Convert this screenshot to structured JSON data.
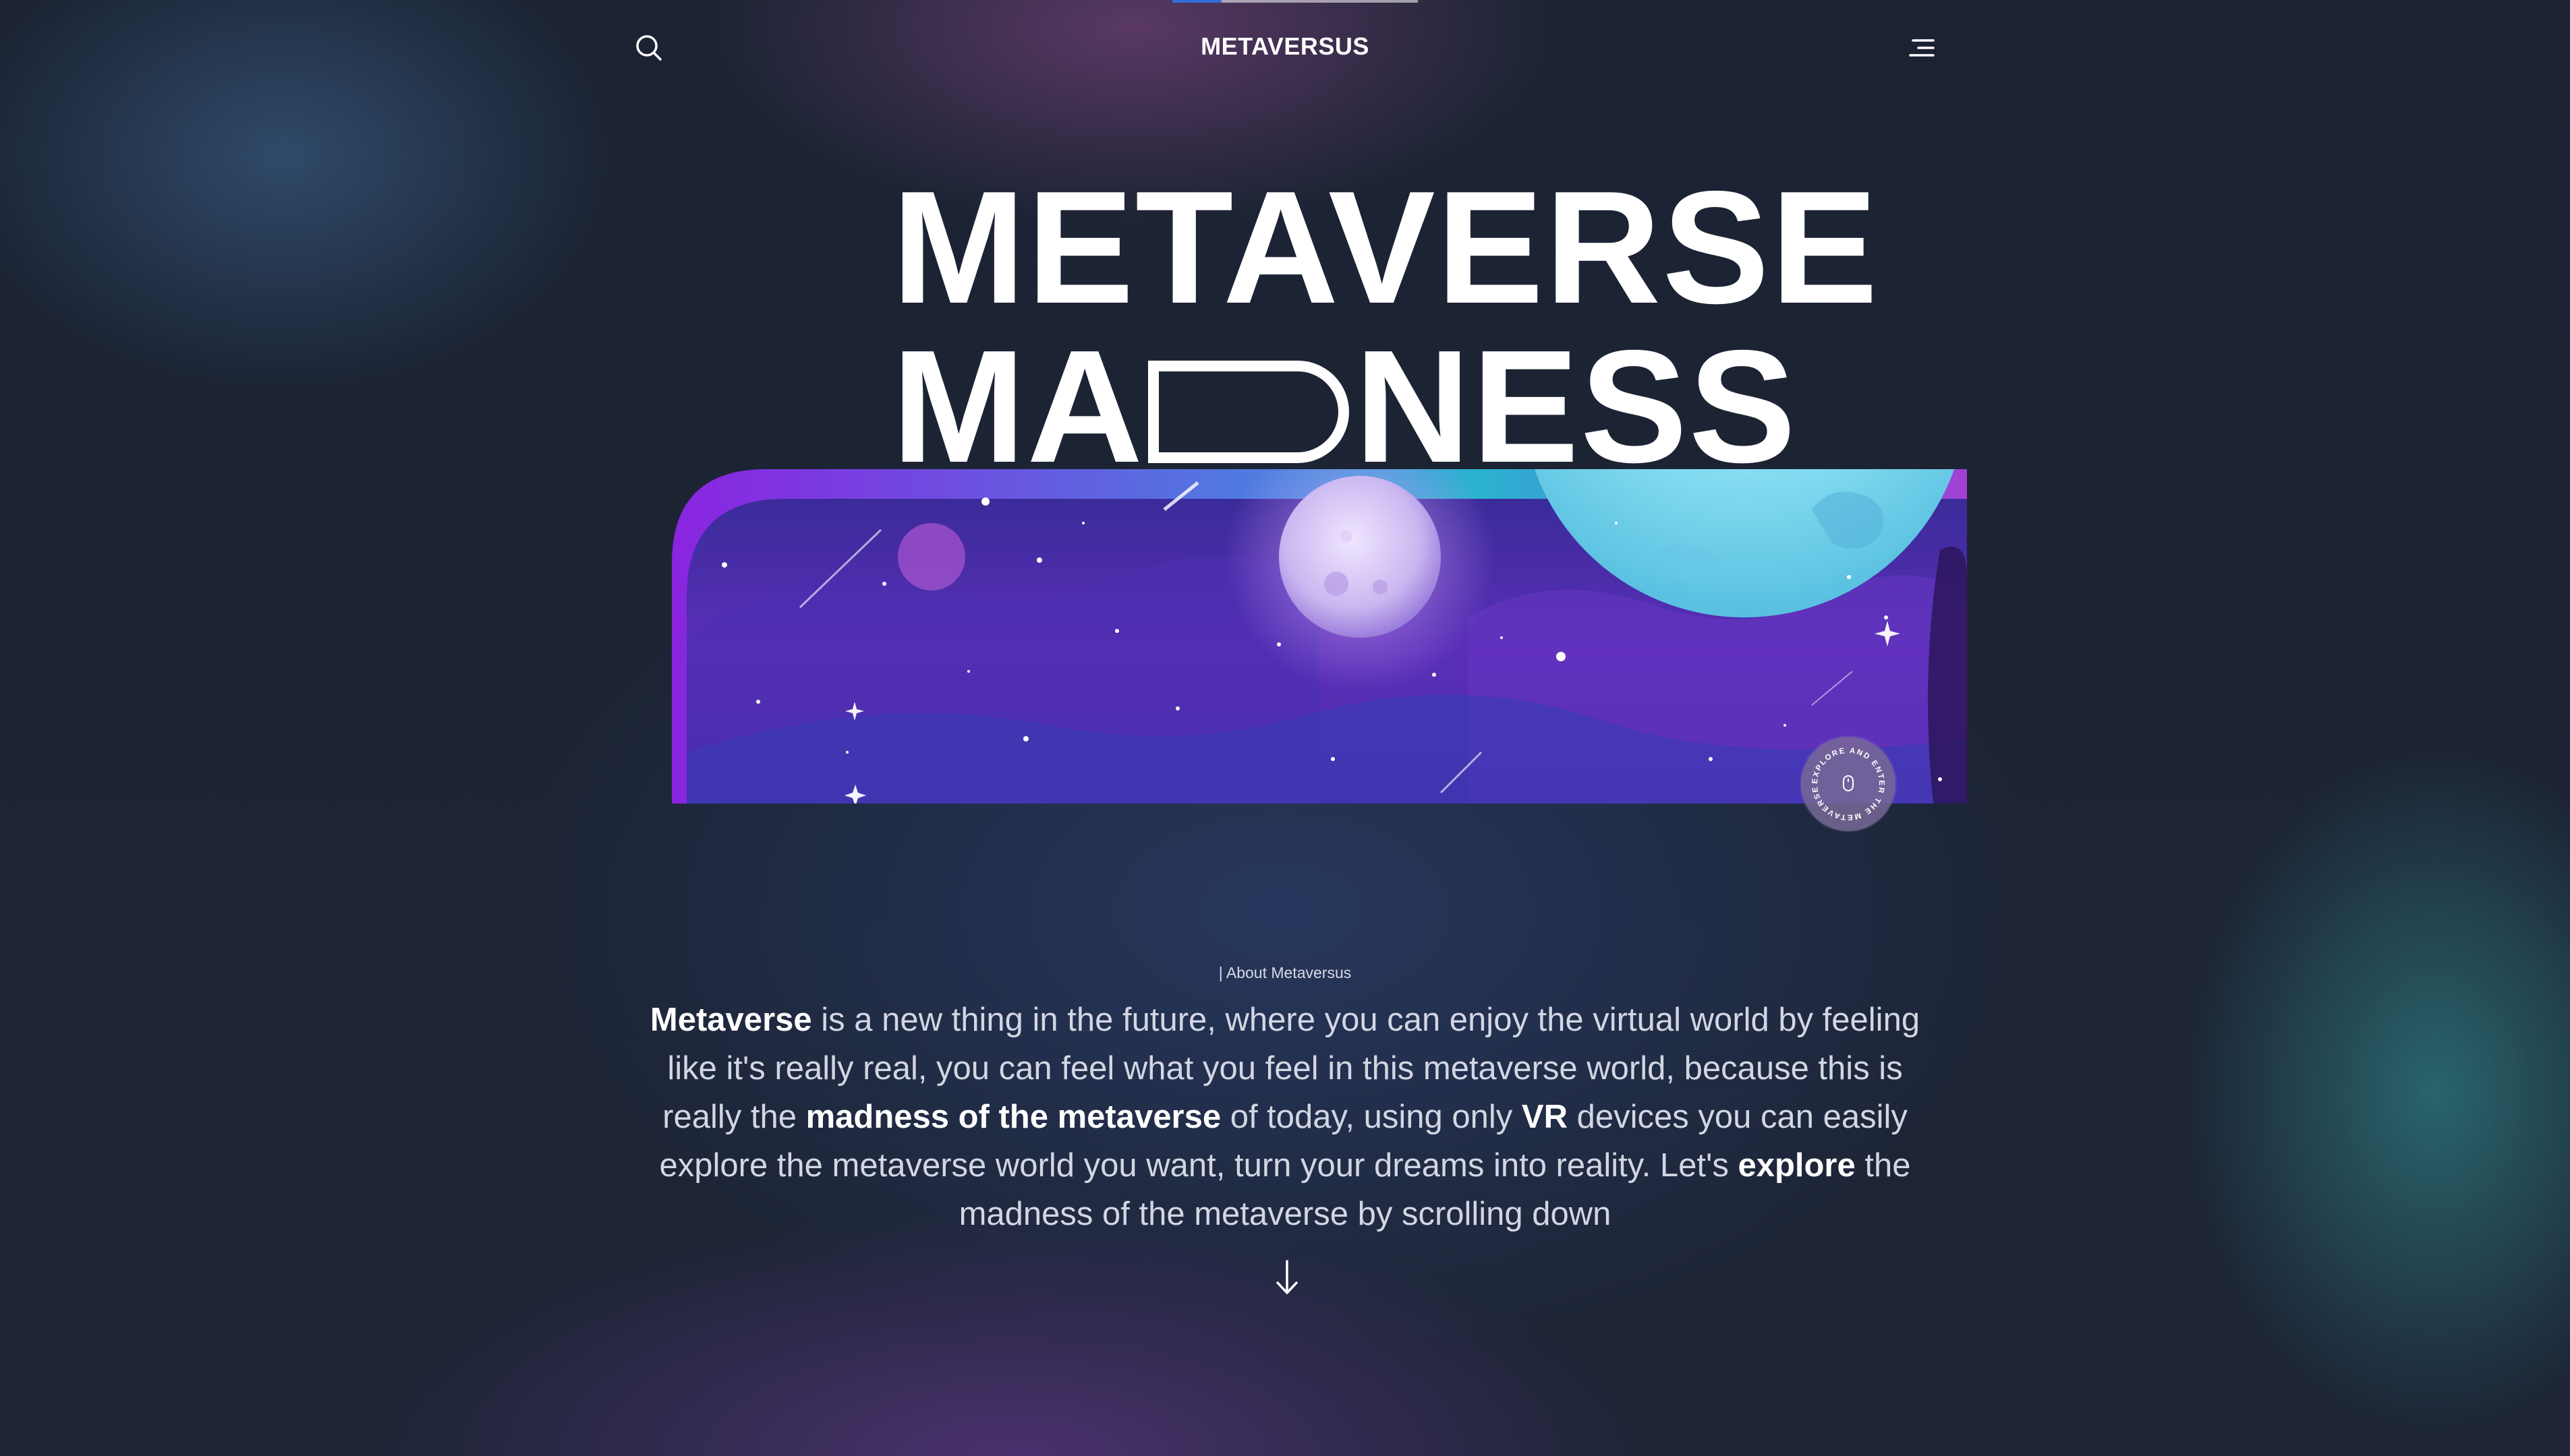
{
  "header": {
    "brand": "METAVERSUS",
    "search_icon": "search-icon",
    "menu_icon": "menu-icon"
  },
  "scroll_progress": 0.2,
  "hero": {
    "line1": "METAVERSE",
    "line2_before": "MA",
    "line2_after": "NESS"
  },
  "badge": {
    "text": "EXPLORE AND ENTER THE METAVERSE",
    "icon": "mouse-icon"
  },
  "about": {
    "label": "| About Metaversus",
    "p1_bold": "Metaverse",
    "p1": " is a new thing in the future, where you can enjoy the virtual world by feeling like it's really real, you can feel what you feel in this metaverse world, because this is really the ",
    "p2_bold": "madness of the metaverse",
    "p2": " of today, using only ",
    "p3_bold": "VR",
    "p3": " devices you can easily explore the metaverse world you want, turn your dreams into reality. Let's ",
    "p4_bold": "explore",
    "p4": " the madness of the metaverse by scrolling down"
  },
  "scroll_icon": "arrow-down-icon",
  "colors": {
    "accent_purple": "#8a2be2",
    "accent_cyan": "#2ab3cf",
    "progress": "#2f6fd6"
  }
}
